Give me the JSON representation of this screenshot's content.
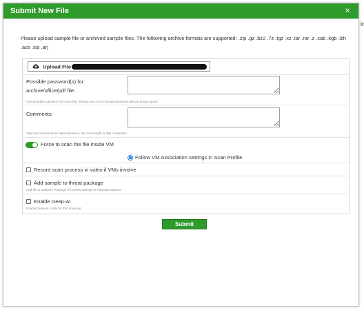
{
  "dialog": {
    "title": "Submit New File",
    "close_label": "×",
    "side_mark": "ir"
  },
  "intro_text": "Please upload sample file or archived sample files. The following archive formats are supported: .zip .gz .bz2 .7z .tgz .xz .tar .rar .z .cab .kgb .lzh .ace .iso .arj",
  "upload": {
    "label": "Upload File",
    "icon": "cloud-upload-icon"
  },
  "password": {
    "label": "Possible password(s) for archive/office/pdf file:",
    "value": "",
    "hint": "One possible password for each line. Please use ASCII format password without empty space."
  },
  "comments": {
    "label": "Comments:",
    "value": "",
    "hint": "Optional comments for later reference, the max length is 255 characters"
  },
  "force_scan": {
    "label": "Force to scan the file inside VM",
    "enabled": true
  },
  "vm_association": {
    "label": "Follow VM Association settings in Scan Profile",
    "selected": true
  },
  "record_video": {
    "label": "Record scan process in video if VMs involve"
  },
  "threat_package": {
    "label": "Add sample to threat package",
    "hint": "Add file to Malware Package if it meets settings in Package Options"
  },
  "deep_ai": {
    "label": "Enable Deep-AI",
    "hint": "Enable Deep-AI mode for this scanning"
  },
  "submit_label": "Submit",
  "colors": {
    "accent_green": "#2e9b2b",
    "radio_blue": "#1a73e8"
  }
}
